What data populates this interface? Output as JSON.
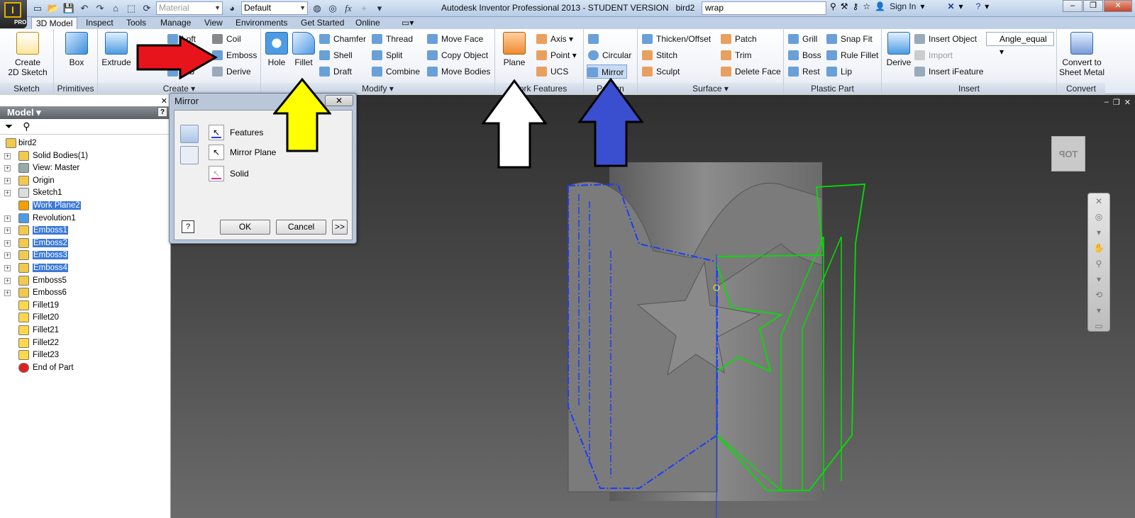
{
  "app": {
    "title": "Autodesk Inventor Professional 2013 - STUDENT VERSION",
    "document": "bird2",
    "badge": "PRO",
    "material": "Material",
    "appearance": "Default",
    "search": "wrap",
    "signin": "Sign In",
    "fx": "fx"
  },
  "tabs": [
    "3D Model",
    "Inspect",
    "Tools",
    "Manage",
    "View",
    "Environments",
    "Get Started",
    "Online"
  ],
  "ribbon": {
    "sketch": {
      "title": "Sketch",
      "create_2d": "Create\n2D Sketch"
    },
    "primitives": {
      "title": "Primitives",
      "box": "Box"
    },
    "create": {
      "title": "Create",
      "extrude": "Extrude",
      "revolve": "R",
      "loft": "Loft",
      "coil": "Coil",
      "emboss": "Emboss",
      "rib": "Rib",
      "derive": "Derive"
    },
    "modify": {
      "title": "Modify",
      "hole": "Hole",
      "fillet": "Fillet",
      "chamfer": "Chamfer",
      "shell": "Shell",
      "draft": "Draft",
      "thread": "Thread",
      "split": "Split",
      "combine": "Combine",
      "move_face": "Move Face",
      "copy_object": "Copy Object",
      "move_bodies": "Move Bodies"
    },
    "work_features": {
      "title": "Work Features",
      "plane": "Plane",
      "axis": "Axis",
      "point": "Point",
      "ucs": "UCS"
    },
    "pattern": {
      "title": "Pattern",
      "circular": "Circular",
      "mirror": "Mirror"
    },
    "surface": {
      "title": "Surface",
      "thicken": "Thicken/Offset",
      "stitch": "Stitch",
      "sculpt": "Sculpt",
      "patch": "Patch",
      "trim": "Trim",
      "delete_face": "Delete Face"
    },
    "plastic": {
      "title": "Plastic Part",
      "grill": "Grill",
      "boss": "Boss",
      "rest": "Rest",
      "snap_fit": "Snap Fit",
      "rule_fillet": "Rule Fillet",
      "lip": "Lip"
    },
    "insert": {
      "title": "Insert",
      "derive": "Derive",
      "insert_object": "Insert Object",
      "import": "Import",
      "insert_ifeature": "Insert iFeature",
      "style": "Angle_equal"
    },
    "convert": {
      "title": "Convert",
      "sheet_metal": "Convert to\nSheet Metal"
    }
  },
  "model_browser": {
    "header": "Model",
    "items": [
      {
        "label": "bird2",
        "selected": false,
        "expand": false,
        "root": true
      },
      {
        "label": "Solid Bodies(1)",
        "selected": false,
        "expand": true
      },
      {
        "label": "View: Master",
        "selected": false,
        "expand": true
      },
      {
        "label": "Origin",
        "selected": false,
        "expand": true
      },
      {
        "label": "Sketch1",
        "selected": false,
        "expand": true
      },
      {
        "label": "Work Plane2",
        "selected": true,
        "expand": false
      },
      {
        "label": "Revolution1",
        "selected": false,
        "expand": true
      },
      {
        "label": "Emboss1",
        "selected": true,
        "expand": true
      },
      {
        "label": "Emboss2",
        "selected": true,
        "expand": true
      },
      {
        "label": "Emboss3",
        "selected": true,
        "expand": true
      },
      {
        "label": "Emboss4",
        "selected": true,
        "expand": true
      },
      {
        "label": "Emboss5",
        "selected": false,
        "expand": true
      },
      {
        "label": "Emboss6",
        "selected": false,
        "expand": true
      },
      {
        "label": "Fillet19",
        "selected": false,
        "expand": false
      },
      {
        "label": "Fillet20",
        "selected": false,
        "expand": false
      },
      {
        "label": "Fillet21",
        "selected": false,
        "expand": false
      },
      {
        "label": "Fillet22",
        "selected": false,
        "expand": false
      },
      {
        "label": "Fillet23",
        "selected": false,
        "expand": false
      },
      {
        "label": "End of Part",
        "selected": false,
        "expand": false
      }
    ]
  },
  "mirror_dialog": {
    "title": "Mirror",
    "features": "Features",
    "mirror_plane": "Mirror Plane",
    "solid": "Solid",
    "ok": "OK",
    "cancel": "Cancel",
    "more": ">>",
    "help": "?"
  },
  "viewcube_label": "TOP",
  "colors": {
    "arrow_red": "#e8141b",
    "arrow_yellow": "#ffff00",
    "arrow_white": "#ffffff",
    "arrow_blue": "#3a4fcf",
    "wire_blue": "#1a3cff",
    "wire_green": "#00e000",
    "selection": "#3b78d8"
  }
}
